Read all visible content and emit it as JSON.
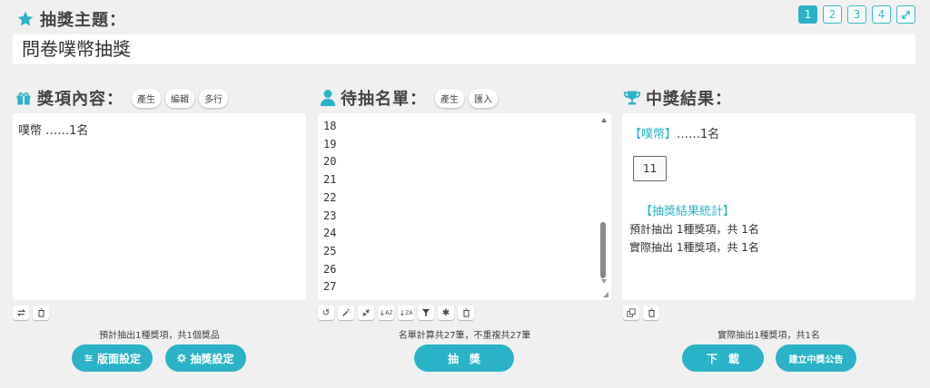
{
  "header": {
    "title": "抽獎主題：",
    "topic": "問卷噗幣抽獎",
    "pages": [
      "1",
      "2",
      "3",
      "4"
    ]
  },
  "prizes": {
    "title": "獎項內容：",
    "pills": [
      "產生",
      "編輯",
      "多行"
    ],
    "content": "噗幣 ……1名",
    "note": "預計抽出1種獎項，共1個獎品",
    "btn_layout": "版面設定",
    "btn_draw_settings": "抽獎設定"
  },
  "candidates": {
    "title": "待抽名單：",
    "pills": [
      "產生",
      "匯入"
    ],
    "lines": [
      "18",
      "19",
      "20",
      "21",
      "22",
      "23",
      "24",
      "25",
      "26",
      "27"
    ],
    "note": "名單計算共27筆，不重複共27筆",
    "btn_draw": "抽　獎"
  },
  "results": {
    "title": "中獎結果：",
    "prize_name": "【噗幣】",
    "prize_count": "……1名",
    "winner": "11",
    "stat_title": "【抽獎結果統計】",
    "stat_expected": "預計抽出 1種獎項，共 1名",
    "stat_actual": "實際抽出 1種獎項，共 1名",
    "note": "實際抽出1種獎項，共1名",
    "btn_download": "下　載",
    "btn_announce": "建立中獎公告"
  },
  "colors": {
    "accent": "#2ab3c8",
    "background": "#f0f0f0"
  }
}
